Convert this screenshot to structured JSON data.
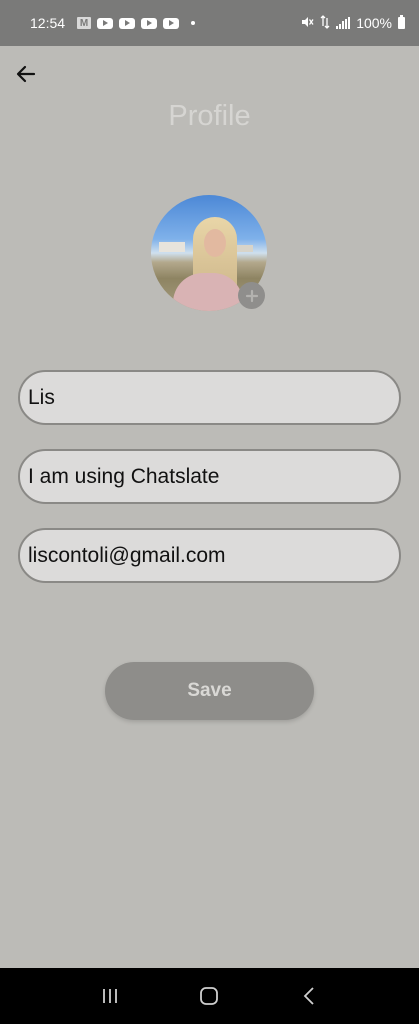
{
  "status_bar": {
    "time": "12:54",
    "gmail_label": "M",
    "battery": "100%",
    "icons": [
      "gmail-icon",
      "youtube-icon",
      "youtube-icon",
      "youtube-icon",
      "youtube-icon",
      "mute-icon",
      "data-icon",
      "signal-icon",
      "battery-icon"
    ]
  },
  "header": {
    "back_icon": "arrow-left-icon",
    "title": "Profile"
  },
  "avatar": {
    "add_icon": "plus-icon"
  },
  "form": {
    "name_value": "Lis",
    "status_value": "I am using Chatslate",
    "email_value": "liscontoli@gmail.com",
    "save_label": "Save"
  },
  "nav_bar": {
    "icons": [
      "recent-apps-icon",
      "home-icon",
      "back-icon"
    ]
  },
  "colors": {
    "background": "#bcbbb7",
    "status_bar": "#7a7a79",
    "field_fill": "#dcdbda",
    "field_border": "#8a8986",
    "button": "#8e8d8a",
    "title": "#d6d5d2"
  }
}
